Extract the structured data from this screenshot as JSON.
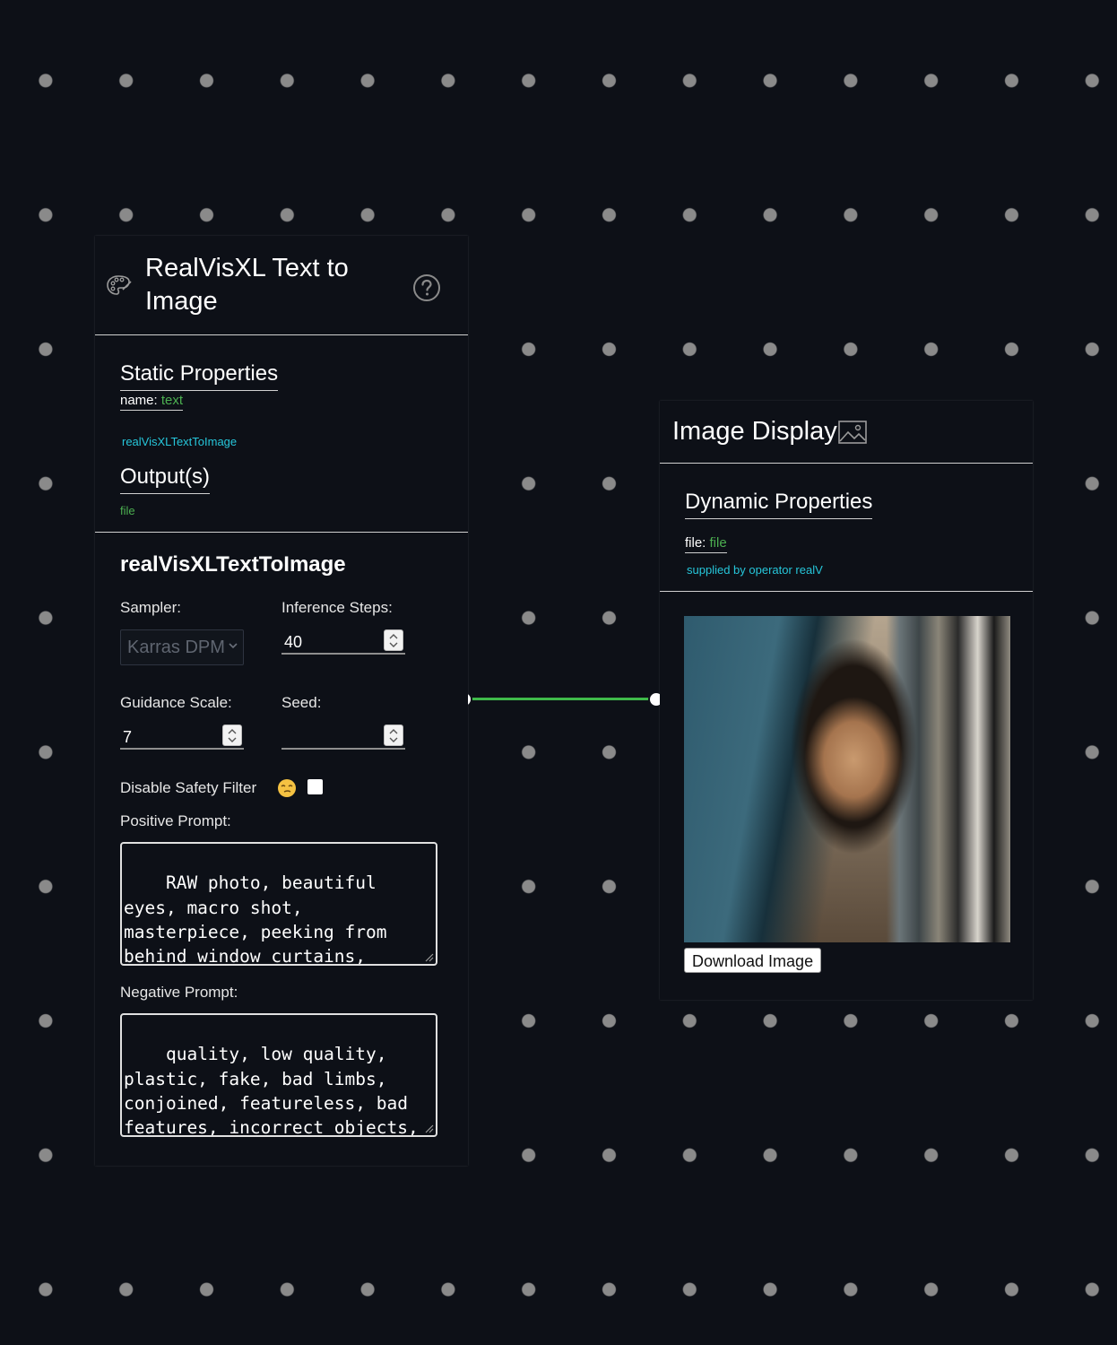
{
  "left_node": {
    "title": "RealVisXL Text to Image",
    "static_section": "Static Properties",
    "name_label": "name:",
    "name_type": "text",
    "name_value": "realVisXLTextToImage",
    "outputs_section": "Output(s)",
    "output_type": "file",
    "operator_name": "realVisXLTextToImage",
    "sampler_label": "Sampler:",
    "sampler_value": "Karras DPM",
    "steps_label": "Inference Steps:",
    "steps_value": "40",
    "guidance_label": "Guidance Scale:",
    "guidance_value": "7",
    "seed_label": "Seed:",
    "seed_value": "",
    "safety_label": "Disable Safety Filter",
    "positive_label": "Positive Prompt:",
    "positive_value": "RAW photo, beautiful eyes, macro shot, masterpiece, peeking from behind window curtains, colorful details, award winning, high detailed,",
    "negative_label": "Negative Prompt:",
    "negative_value": "quality, low quality, plastic, fake, bad limbs, conjoined, featureless, bad features, incorrect objects, watermark, logo"
  },
  "right_node": {
    "title": "Image Display",
    "dynamic_section": "Dynamic Properties",
    "file_label": "file:",
    "file_type": "file",
    "supplied_text": "supplied by operator realV",
    "download_label": "Download Image"
  },
  "icons": [
    "palette-icon",
    "help-icon",
    "image-icon",
    "emoji-icon",
    "chevron-down-icon",
    "spinner-icon"
  ],
  "colors": {
    "background": "#0d1017",
    "type_green": "#4caf50",
    "info_cyan": "#26c6da",
    "connector": "#3fba4a"
  }
}
